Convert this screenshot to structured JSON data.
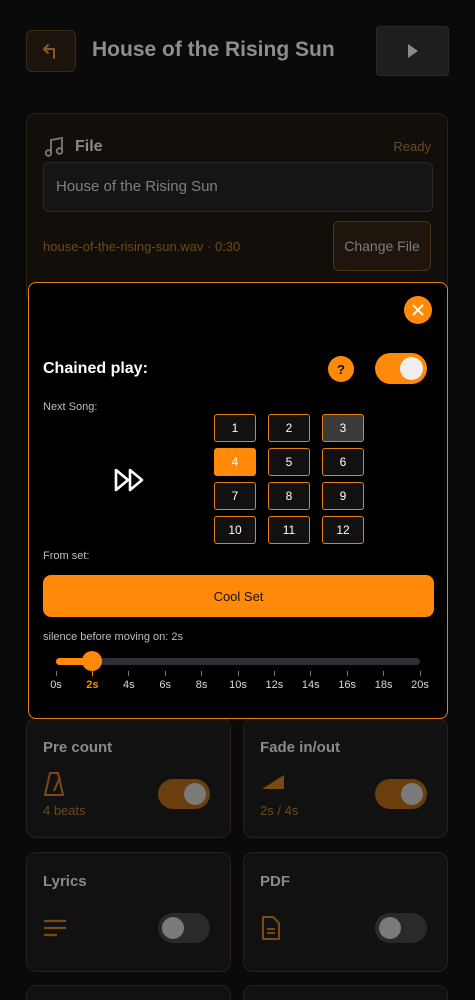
{
  "header": {
    "title": "House of the Rising Sun",
    "back_icon": "back-arrow-icon",
    "play_icon": "play-icon"
  },
  "file_card": {
    "label": "File",
    "status": "Ready",
    "song_name": "House of the Rising Sun",
    "file_meta": "house-of-the-rising-sun.wav · 0:30",
    "change_button": "Change File",
    "icon": "music-note-icon"
  },
  "modal": {
    "chained_play_label": "Chained play:",
    "help_label": "?",
    "chained_play_enabled": true,
    "next_song_label": "Next Song:",
    "song_numbers": [
      "1",
      "2",
      "3",
      "4",
      "5",
      "6",
      "7",
      "8",
      "9",
      "10",
      "11",
      "12"
    ],
    "selected_song": "4",
    "current_song": "3",
    "from_set_label": "From set:",
    "set_button": "Cool Set",
    "silence_label": "silence before moving on: 2s",
    "silence_ticks": [
      "0s",
      "2s",
      "4s",
      "6s",
      "8s",
      "10s",
      "12s",
      "14s",
      "16s",
      "18s",
      "20s"
    ],
    "silence_value": 2,
    "silence_max": 20
  },
  "tiles": {
    "precount": {
      "title": "Pre count",
      "sub": "4 beats",
      "enabled": true,
      "icon": "metronome-icon"
    },
    "fade": {
      "title": "Fade in/out",
      "sub": "2s / 4s",
      "enabled": true,
      "icon": "fade-ramp-icon"
    },
    "lyrics": {
      "title": "Lyrics",
      "enabled": false,
      "icon": "lines-icon"
    },
    "pdf": {
      "title": "PDF",
      "enabled": false,
      "icon": "document-icon"
    }
  },
  "colors": {
    "accent": "#ff8a0a",
    "background": "#0a0a0a"
  }
}
